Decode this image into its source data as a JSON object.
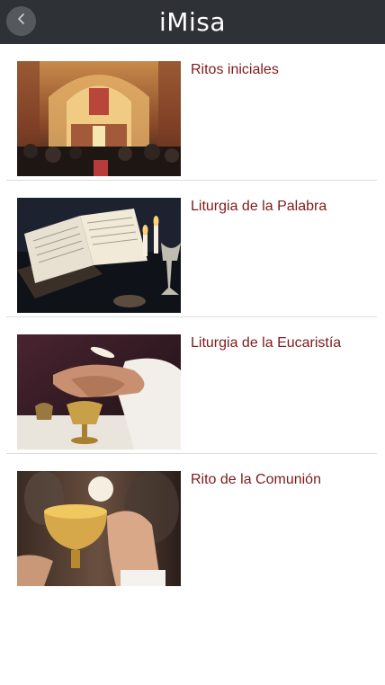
{
  "header": {
    "title": "iMisa",
    "back_icon": "chevron-left-icon"
  },
  "items": [
    {
      "label": "Ritos iniciales"
    },
    {
      "label": "Liturgia de la Palabra"
    },
    {
      "label": "Liturgia de la Eucaristía"
    },
    {
      "label": "Rito de la Comunión"
    }
  ]
}
